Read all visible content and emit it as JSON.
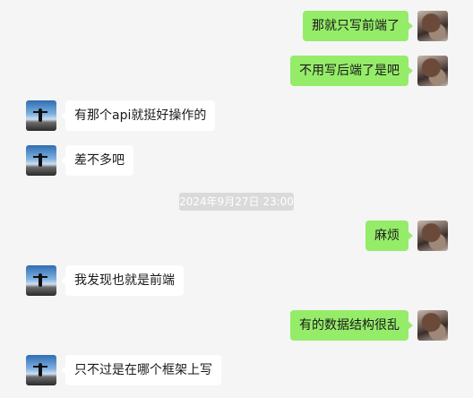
{
  "colors": {
    "background": "#f5f5f5",
    "outgoing_bubble": "#95ec69",
    "incoming_bubble": "#ffffff",
    "timestamp_bg": "#dadada"
  },
  "messages": [
    {
      "direction": "out",
      "text": "那就只写前端了"
    },
    {
      "direction": "out",
      "text": "不用写后端了是吧"
    },
    {
      "direction": "in",
      "text": "有那个api就挺好操作的"
    },
    {
      "direction": "in",
      "text": "差不多吧"
    },
    {
      "direction": "out",
      "text": "麻烦"
    },
    {
      "direction": "in",
      "text": "我发现也就是前端"
    },
    {
      "direction": "out",
      "text": "有的数据结构很乱"
    },
    {
      "direction": "in",
      "text": "只不过是在哪个框架上写"
    }
  ],
  "timestamp": "2024年9月27日 23:00",
  "icons": {
    "my_avatar": "my-avatar",
    "friend_avatar": "friend-avatar"
  }
}
